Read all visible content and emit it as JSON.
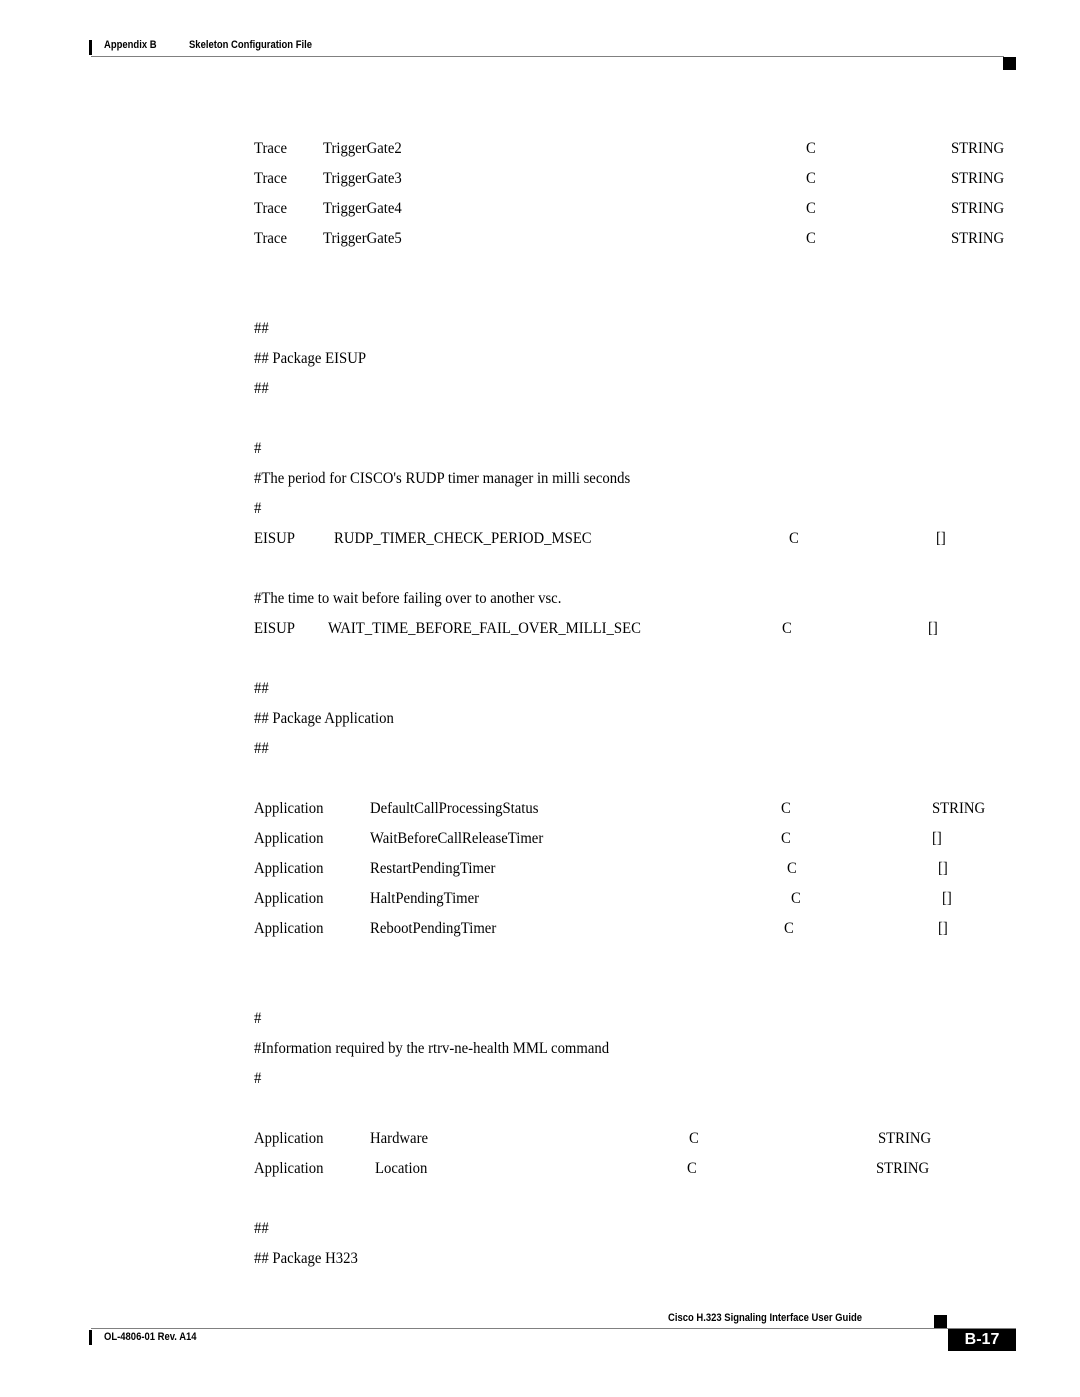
{
  "header": {
    "appendix": "Appendix B",
    "chapter_title": "Skeleton Configuration File"
  },
  "body": {
    "trace_rows": [
      {
        "pkg": "Trace",
        "name": "TriggerGate2",
        "flag": "C",
        "type": "STRING"
      },
      {
        "pkg": "Trace",
        "name": "TriggerGate3",
        "flag": "C",
        "type": "STRING"
      },
      {
        "pkg": "Trace",
        "name": "TriggerGate4",
        "flag": "C",
        "type": "STRING"
      },
      {
        "pkg": "Trace",
        "name": "TriggerGate5",
        "flag": "C",
        "type": "STRING"
      }
    ],
    "eisup_section": {
      "banner_top": "##",
      "banner_title": "## Package EISUP",
      "banner_bottom": "##",
      "comment_top": "#",
      "comment_rudp": "#The period for CISCO's RUDP timer manager in milli seconds",
      "comment_bottom": "#",
      "rows": [
        {
          "pkg": "EISUP",
          "name": "RUDP_TIMER_CHECK_PERIOD_MSEC",
          "flag": "C",
          "type": "[]"
        },
        {
          "pkg": "EISUP",
          "name": "WAIT_TIME_BEFORE_FAIL_OVER_MILLI_SEC",
          "flag": "C",
          "type": "[]"
        }
      ],
      "comment_failover": "#The time to wait before failing over to another vsc."
    },
    "application_section": {
      "banner_top": "##",
      "banner_title": "## Package Application",
      "banner_bottom": "##",
      "rows": [
        {
          "pkg": "Application",
          "name": "DefaultCallProcessingStatus",
          "flag": "C",
          "type": "STRING"
        },
        {
          "pkg": "Application",
          "name": "WaitBeforeCallReleaseTimer",
          "flag": "C",
          "type": "[]"
        },
        {
          "pkg": "Application",
          "name": "RestartPendingTimer",
          "flag": "C",
          "type": "[]"
        },
        {
          "pkg": "Application",
          "name": "HaltPendingTimer",
          "flag": "C",
          "type": "[]"
        },
        {
          "pkg": "Application",
          "name": "RebootPendingTimer",
          "flag": "C",
          "type": "[]"
        }
      ],
      "comment_top": "#",
      "comment_health": "#Information required by the rtrv-ne-health MML command",
      "comment_bottom": "#",
      "health_rows": [
        {
          "pkg": "Application",
          "name": "Hardware",
          "flag": "C",
          "type": "STRING"
        },
        {
          "pkg": "Application",
          "name": "Location",
          "flag": "C",
          "type": "STRING"
        }
      ]
    },
    "h323_section": {
      "banner_top": "##",
      "banner_title": "## Package H323"
    }
  },
  "footer": {
    "guide_title": "Cisco H.323 Signaling Interface User Guide",
    "doc_number": "OL-4806-01 Rev. A14",
    "page_number": "B-17"
  }
}
